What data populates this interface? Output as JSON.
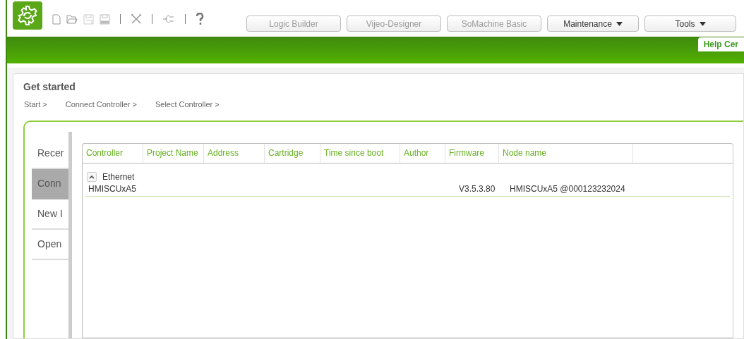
{
  "toolbar": {
    "app_buttons": [
      {
        "label": "Logic Builder",
        "disabled": true,
        "dropdown": false
      },
      {
        "label": "Vijeo-Designer",
        "disabled": true,
        "dropdown": false
      },
      {
        "label": "SoMachine Basic",
        "disabled": true,
        "dropdown": false
      },
      {
        "label": "Maintenance",
        "disabled": false,
        "dropdown": true
      },
      {
        "label": "Tools",
        "disabled": false,
        "dropdown": true
      }
    ]
  },
  "help_tab": "Help Cer",
  "page": {
    "title": "Get started",
    "breadcrumb": [
      "Start >",
      "Connect Controller >",
      "Select Controller >"
    ],
    "side_tabs": [
      {
        "label": "Recer",
        "selected": false
      },
      {
        "label": "Conn",
        "selected": true
      },
      {
        "label": "New I",
        "selected": false
      },
      {
        "label": "Open",
        "selected": false
      }
    ],
    "table": {
      "columns": [
        "Controller",
        "Project Name",
        "Address",
        "Cartridge",
        "Time since boot",
        "Author",
        "Firmware",
        "Node name"
      ],
      "groups": [
        {
          "label": "Ethernet",
          "expanded": true,
          "rows": [
            {
              "controller": "HMISCUxA5",
              "firmware": "V3.5.3.80",
              "node_name": "HMISCUxA5 @000123232024"
            }
          ]
        }
      ]
    }
  }
}
